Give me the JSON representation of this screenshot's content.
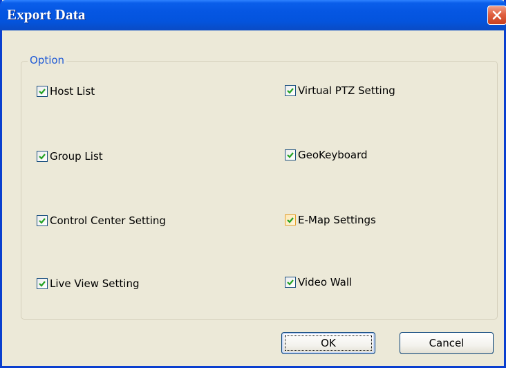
{
  "window": {
    "title": "Export Data"
  },
  "group": {
    "legend": "Option"
  },
  "options": {
    "host_list": "Host List",
    "group_list": "Group List",
    "control_center_setting": "Control Center Setting",
    "live_view_setting": "Live View Setting",
    "virtual_ptz_setting": "Virtual PTZ Setting",
    "geokeyboard": "GeoKeyboard",
    "emap_settings": "E-Map Settings",
    "video_wall": "Video Wall"
  },
  "buttons": {
    "ok": "OK",
    "cancel": "Cancel"
  },
  "state": {
    "all_checked": true
  },
  "colors": {
    "title_bar": "#0454dd",
    "window_background": "#ece9d8",
    "legend_text": "#1f5ad6",
    "check_mark": "#21a121",
    "close_button": "#e06040"
  },
  "icons": {
    "close": "close-icon",
    "check": "checkmark-icon"
  }
}
